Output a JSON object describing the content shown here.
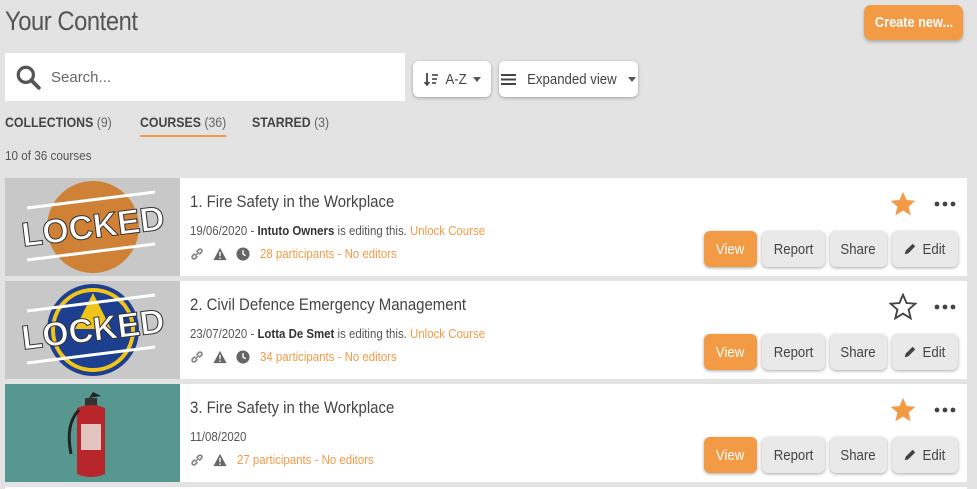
{
  "page": {
    "title": "Your Content",
    "create_label": "Create new..."
  },
  "search": {
    "placeholder": "Search..."
  },
  "toolbar": {
    "sort_label": "A-Z",
    "view_label": "Expanded view"
  },
  "tabs": [
    {
      "label": "COLLECTIONS",
      "count": "(9)",
      "active": false
    },
    {
      "label": "COURSES",
      "count": "(36)",
      "active": true
    },
    {
      "label": "STARRED",
      "count": "(3)",
      "active": false
    }
  ],
  "count_text": "10 of 36 courses",
  "colors": {
    "accent": "#f39a45",
    "background": "#e3e3e3"
  },
  "courses": [
    {
      "title": "1. Fire Safety in the Workplace",
      "date": "19/06/2020",
      "sep": " - ",
      "editor": "Intuto Owners",
      "editing_text": " is editing this. ",
      "unlock_label": "Unlock Course",
      "participants": "28 participants - No editors",
      "starred": true,
      "locked_label": "LOCKED",
      "thumb": "orange-circle-locked"
    },
    {
      "title": "2. Civil Defence Emergency Management",
      "date": "23/07/2020",
      "sep": " - ",
      "editor": "Lotta De Smet",
      "editing_text": " is editing this. ",
      "unlock_label": "Unlock Course",
      "participants": "34 participants - No editors",
      "starred": false,
      "locked_label": "LOCKED",
      "thumb": "civil-defence-logo-locked"
    },
    {
      "title": "3. Fire Safety in the Workplace",
      "date": "11/08/2020",
      "participants": "27 participants - No editors",
      "starred": true,
      "thumb": "fire-extinguisher-photo"
    }
  ],
  "actions": {
    "view": "View",
    "report": "Report",
    "share": "Share",
    "edit": "Edit"
  }
}
